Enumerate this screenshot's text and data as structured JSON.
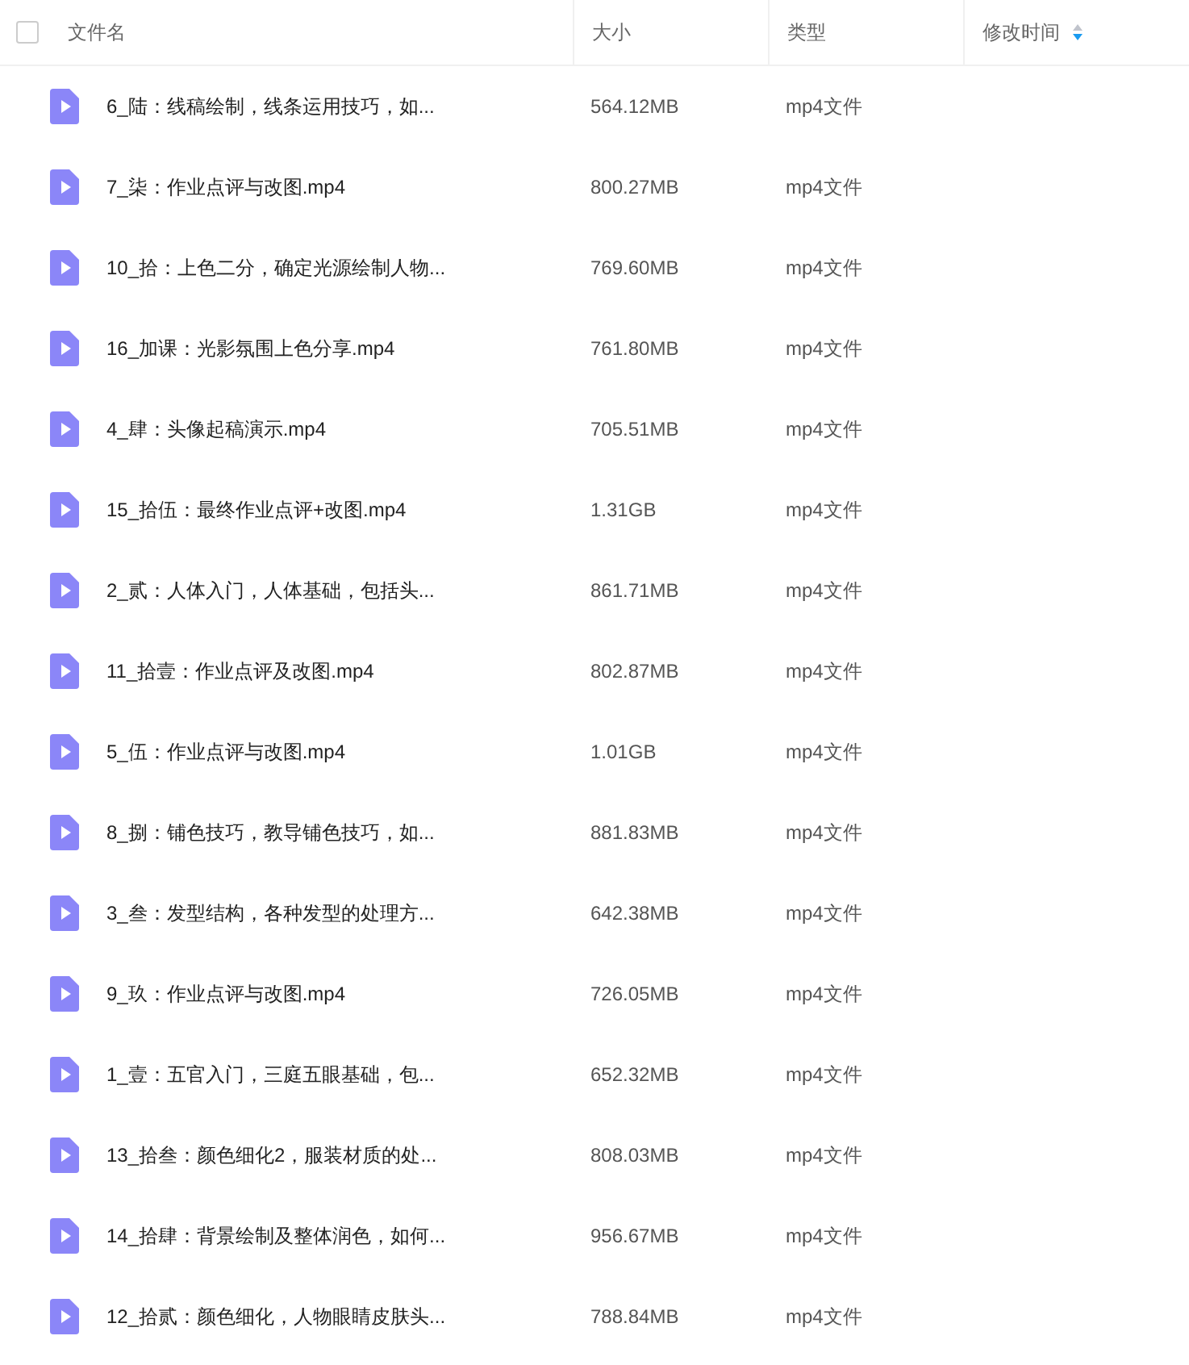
{
  "header": {
    "select_all": {
      "checked": false
    },
    "columns": [
      "文件名",
      "大小",
      "类型",
      "修改时间"
    ]
  },
  "rows": [
    {
      "name": "6_陆：线稿绘制，线条运用技巧，如...",
      "size": "564.12MB",
      "type": "mp4文件"
    },
    {
      "name": "7_柒：作业点评与改图.mp4",
      "size": "800.27MB",
      "type": "mp4文件"
    },
    {
      "name": "10_拾：上色二分，确定光源绘制人物...",
      "size": "769.60MB",
      "type": "mp4文件"
    },
    {
      "name": "16_加课：光影氛围上色分享.mp4",
      "size": "761.80MB",
      "type": "mp4文件"
    },
    {
      "name": "4_肆：头像起稿演示.mp4",
      "size": "705.51MB",
      "type": "mp4文件"
    },
    {
      "name": "15_拾伍：最终作业点评+改图.mp4",
      "size": "1.31GB",
      "type": "mp4文件"
    },
    {
      "name": "2_贰：人体入门，人体基础，包括头...",
      "size": "861.71MB",
      "type": "mp4文件"
    },
    {
      "name": "11_拾壹：作业点评及改图.mp4",
      "size": "802.87MB",
      "type": "mp4文件"
    },
    {
      "name": "5_伍：作业点评与改图.mp4",
      "size": "1.01GB",
      "type": "mp4文件"
    },
    {
      "name": "8_捌：铺色技巧，教导铺色技巧，如...",
      "size": "881.83MB",
      "type": "mp4文件"
    },
    {
      "name": "3_叁：发型结构，各种发型的处理方...",
      "size": "642.38MB",
      "type": "mp4文件"
    },
    {
      "name": "9_玖：作业点评与改图.mp4",
      "size": "726.05MB",
      "type": "mp4文件"
    },
    {
      "name": "1_壹：五官入门，三庭五眼基础，包...",
      "size": "652.32MB",
      "type": "mp4文件"
    },
    {
      "name": "13_拾叁：颜色细化2，服装材质的处...",
      "size": "808.03MB",
      "type": "mp4文件"
    },
    {
      "name": "14_拾肆：背景绘制及整体润色，如何...",
      "size": "956.67MB",
      "type": "mp4文件"
    },
    {
      "name": "12_拾贰：颜色细化，人物眼睛皮肤头...",
      "size": "788.84MB",
      "type": "mp4文件"
    }
  ]
}
